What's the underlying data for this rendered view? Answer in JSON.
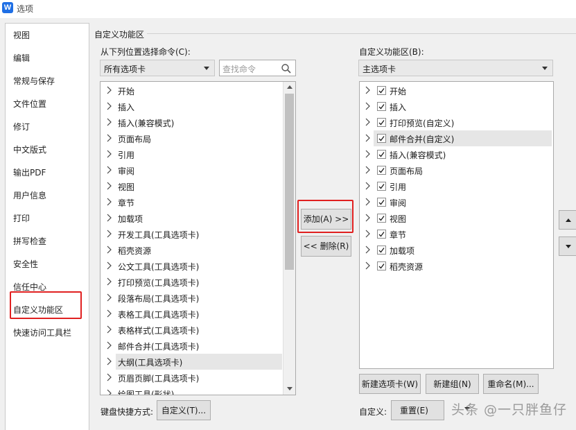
{
  "window": {
    "title": "选项",
    "app_icon": "W"
  },
  "nav": {
    "items": [
      "视图",
      "编辑",
      "常规与保存",
      "文件位置",
      "修订",
      "中文版式",
      "输出PDF",
      "用户信息",
      "打印",
      "拼写检查",
      "安全性",
      "信任中心",
      "自定义功能区",
      "快速访问工具栏"
    ],
    "selected": "自定义功能区"
  },
  "group_title": "自定义功能区",
  "left_panel": {
    "label": "从下列位置选择命令(C):",
    "dropdown_value": "所有选项卡",
    "search_placeholder": "查找命令",
    "items": [
      "开始",
      "插入",
      "插入(兼容模式)",
      "页面布局",
      "引用",
      "审阅",
      "视图",
      "章节",
      "加载项",
      "开发工具(工具选项卡)",
      "稻壳资源",
      "公文工具(工具选项卡)",
      "打印预览(工具选项卡)",
      "段落布局(工具选项卡)",
      "表格工具(工具选项卡)",
      "表格样式(工具选项卡)",
      "邮件合并(工具选项卡)",
      "大纲(工具选项卡)",
      "页眉页脚(工具选项卡)",
      "绘图工具(形状)"
    ],
    "selected": "大纲(工具选项卡)"
  },
  "middle": {
    "add_label": "添加(A) >>",
    "remove_label": "<< 删除(R)"
  },
  "right_panel": {
    "label": "自定义功能区(B):",
    "dropdown_value": "主选项卡",
    "items": [
      {
        "label": "开始",
        "checked": true
      },
      {
        "label": "插入",
        "checked": true
      },
      {
        "label": "打印预览(自定义)",
        "checked": true
      },
      {
        "label": "邮件合并(自定义)",
        "checked": true
      },
      {
        "label": "插入(兼容模式)",
        "checked": true
      },
      {
        "label": "页面布局",
        "checked": true
      },
      {
        "label": "引用",
        "checked": true
      },
      {
        "label": "审阅",
        "checked": true
      },
      {
        "label": "视图",
        "checked": true
      },
      {
        "label": "章节",
        "checked": true
      },
      {
        "label": "加载项",
        "checked": true
      },
      {
        "label": "稻壳资源",
        "checked": true
      }
    ],
    "selected": "邮件合并(自定义)"
  },
  "bottom": {
    "new_tab": "新建选项卡(W)",
    "new_group": "新建组(N)",
    "rename": "重命名(M)...",
    "keyboard_label": "键盘快捷方式:",
    "keyboard_button": "自定义(T)...",
    "custom_label": "自定义:",
    "reset_button": "重置(E)"
  },
  "watermark": "头条 @一只胖鱼仔",
  "colors": {
    "highlight": "#e02020",
    "checkbox_tick": "#1a1a1a",
    "app_icon": "#1f6fe5"
  }
}
